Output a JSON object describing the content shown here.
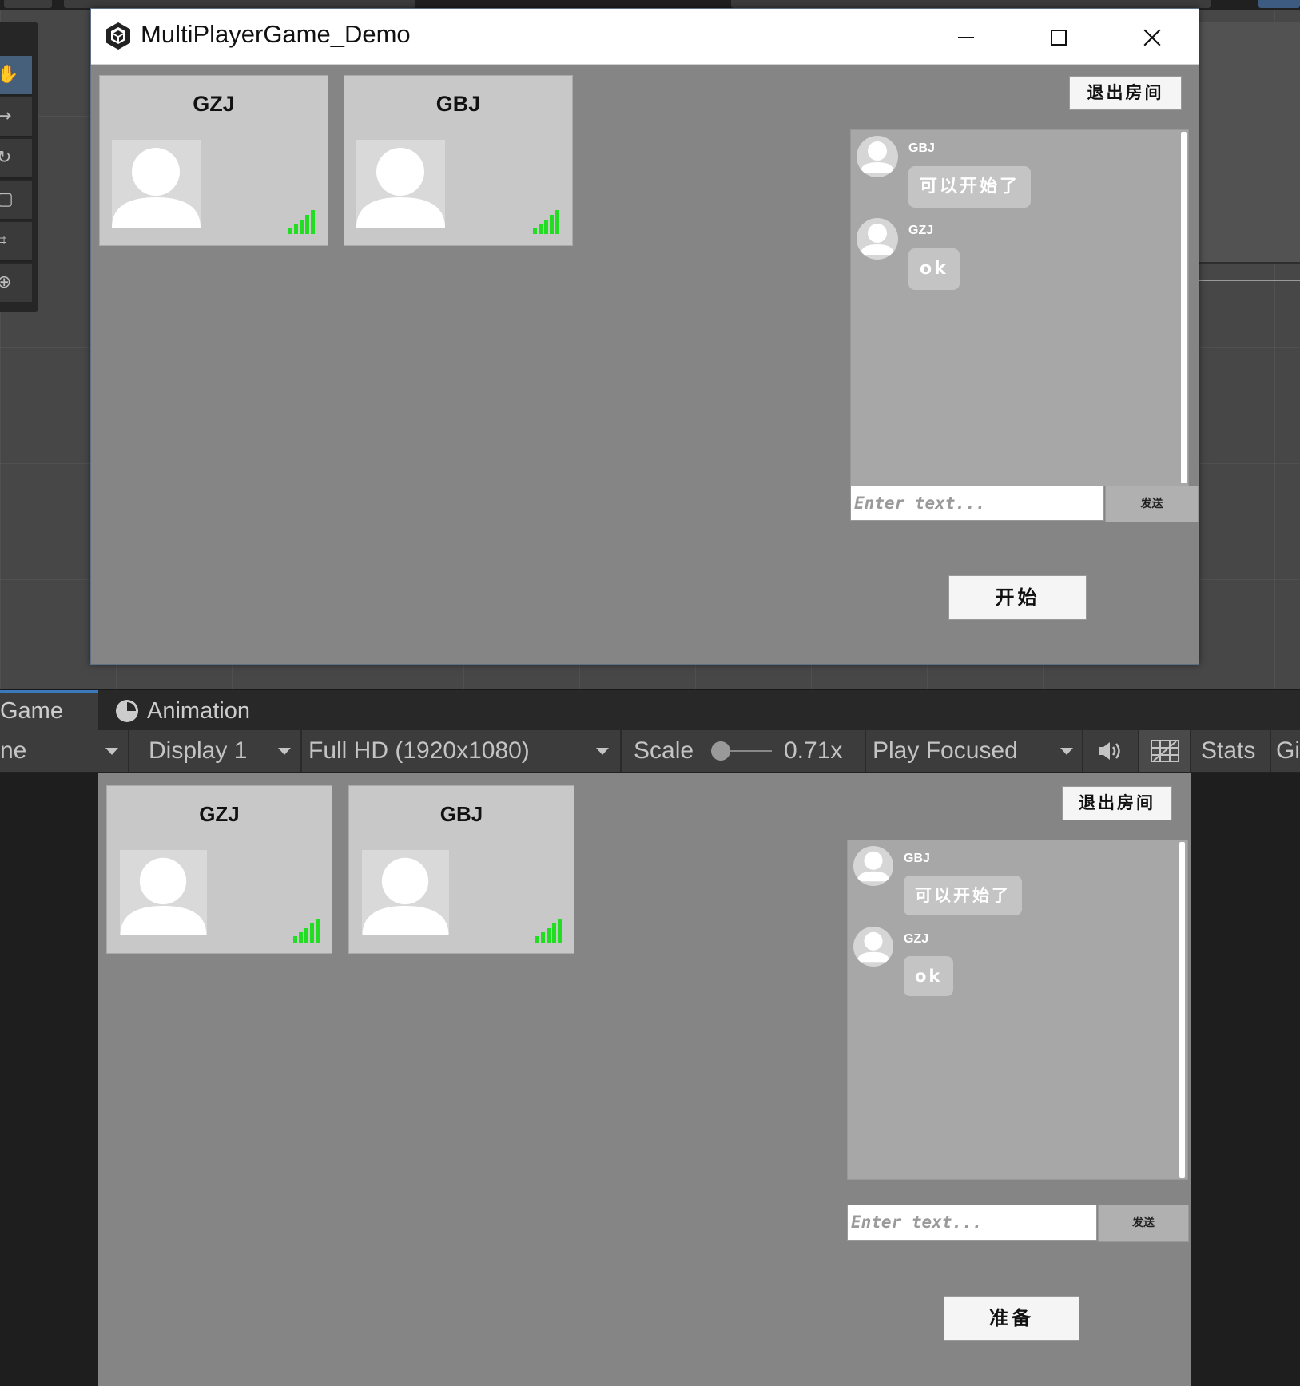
{
  "window": {
    "title": "MultiPlayerGame_Demo",
    "minimize_icon": "minimize-icon",
    "maximize_icon": "maximize-icon",
    "close_icon": "close-icon"
  },
  "editor": {
    "tabs": [
      {
        "label": "Game",
        "icon": null
      },
      {
        "label": "Animation",
        "icon": "clock-icon"
      }
    ],
    "toolbar": {
      "view_dropdown": "ne",
      "display": "Display 1",
      "resolution": "Full HD (1920x1080)",
      "scale_label": "Scale",
      "scale_value": "0.71x",
      "play_mode": "Play Focused",
      "stats": "Stats",
      "gizmos": "Gi"
    }
  },
  "top_game": {
    "players": [
      {
        "name": "GZJ",
        "signal_bars": 5
      },
      {
        "name": "GBJ",
        "signal_bars": 5
      }
    ],
    "exit_label": "退出房间",
    "messages": [
      {
        "sender": "GBJ",
        "text": "可以开始了"
      },
      {
        "sender": "GZJ",
        "text": "ok"
      }
    ],
    "input_placeholder": "Enter text...",
    "send_label": "发送",
    "action_label": "开始"
  },
  "bottom_game": {
    "players": [
      {
        "name": "GZJ",
        "signal_bars": 5
      },
      {
        "name": "GBJ",
        "signal_bars": 5
      }
    ],
    "exit_label": "退出房间",
    "messages": [
      {
        "sender": "GBJ",
        "text": "可以开始了"
      },
      {
        "sender": "GZJ",
        "text": "ok"
      }
    ],
    "input_placeholder": "Enter text...",
    "send_label": "发送",
    "action_label": "准备"
  },
  "colors": {
    "signal": "#22dd22",
    "game_bg": "#858585",
    "card_bg": "#c8c8c8",
    "chat_bg": "#a7a7a7",
    "editor_accent": "#3a79bb"
  }
}
